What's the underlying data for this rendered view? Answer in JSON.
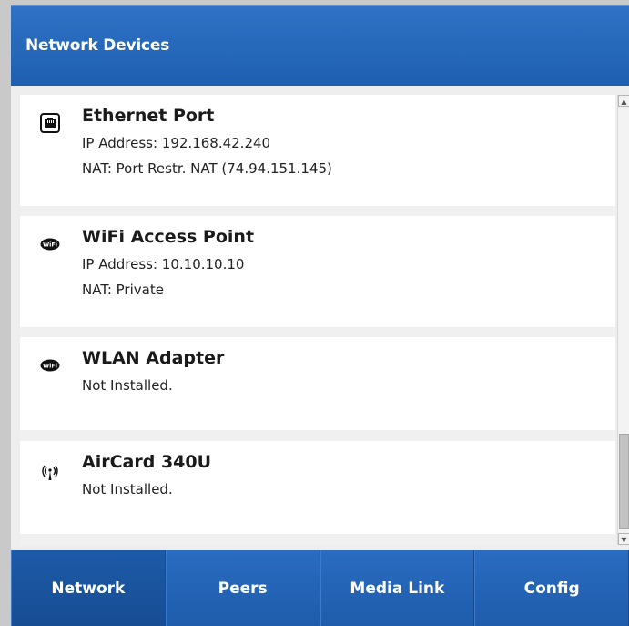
{
  "window": {
    "title": "Network Devices"
  },
  "devices": [
    {
      "icon": "ethernet-port-icon",
      "title": "Ethernet Port",
      "lines": [
        "IP Address: 192.168.42.240",
        "NAT: Port Restr. NAT (74.94.151.145)"
      ]
    },
    {
      "icon": "wifi-icon",
      "title": "WiFi Access Point",
      "lines": [
        "IP Address: 10.10.10.10",
        "NAT: Private"
      ]
    },
    {
      "icon": "wifi-icon",
      "title": "WLAN Adapter",
      "lines": [
        "Not Installed."
      ]
    },
    {
      "icon": "cellular-antenna-icon",
      "title": "AirCard 340U",
      "lines": [
        "Not Installed."
      ]
    }
  ],
  "tabs": [
    {
      "label": "Network",
      "active": true
    },
    {
      "label": "Peers",
      "active": false
    },
    {
      "label": "Media Link",
      "active": false
    },
    {
      "label": "Config",
      "active": false
    }
  ],
  "colors": {
    "header": "#1f5fb0",
    "tab": "#1f5fb0",
    "background": "#eeeeee"
  }
}
